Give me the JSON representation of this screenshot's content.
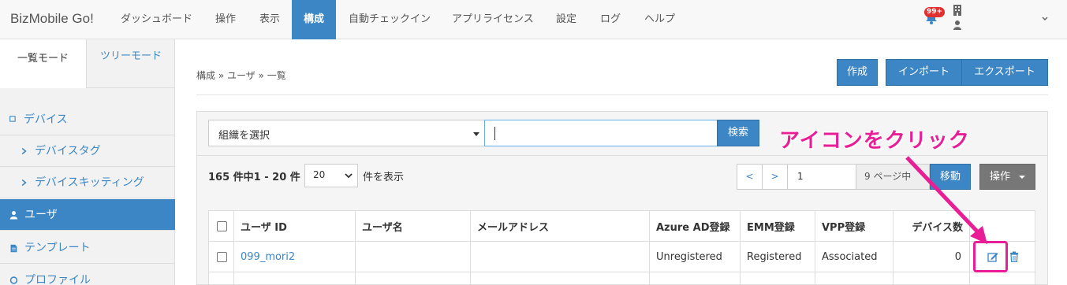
{
  "navbar": {
    "brand": "BizMobile Go!",
    "items": [
      {
        "label": "ダッシュボード"
      },
      {
        "label": "操作"
      },
      {
        "label": "表示"
      },
      {
        "label": "構成"
      },
      {
        "label": "自動チェックイン"
      },
      {
        "label": "アプリライセンス"
      },
      {
        "label": "設定"
      },
      {
        "label": "ログ"
      },
      {
        "label": "ヘルプ"
      }
    ],
    "active_item": "構成",
    "notification_badge": "99+",
    "accent_color": "#3c86c6"
  },
  "sidebar": {
    "mode_tabs": [
      {
        "label": "一覧モード"
      },
      {
        "label": "ツリーモード"
      }
    ],
    "items": [
      {
        "label": "デバイス",
        "icon": "square-icon"
      },
      {
        "label": "デバイスタグ",
        "icon": "chevron-right-icon"
      },
      {
        "label": "デバイスキッティング",
        "icon": "chevron-right-icon"
      },
      {
        "label": "ユーザ",
        "icon": "user-icon",
        "active": true
      },
      {
        "label": "テンプレート",
        "icon": "document-icon"
      },
      {
        "label": "プロファイル",
        "icon": "profile-icon"
      }
    ]
  },
  "main": {
    "breadcrumb": "構成 » ユーザ » 一覧",
    "buttons": {
      "create": "作成",
      "import": "インポート",
      "export": "エクスポート"
    },
    "filter": {
      "org_select": "組織を選択",
      "search_value": "",
      "search_button": "検索"
    },
    "listing": {
      "count_text": "165 件中1 - 20 件",
      "per_page": "20",
      "per_page_label": "件を表示",
      "pager_prev": "<",
      "pager_next": ">",
      "page_input": "1",
      "page_suffix": "9 ページ中",
      "move_button": "移動",
      "action_button": "操作"
    },
    "table": {
      "headers": [
        "ユーザ ID",
        "ユーザ名",
        "メールアドレス",
        "Azure AD登録",
        "EMM登録",
        "VPP登録",
        "デバイス数"
      ],
      "rows": [
        {
          "user_id": "099_mori2",
          "user_name": "",
          "email": "",
          "azure_ad": "Unregistered",
          "emm": "Registered",
          "vpp": "Associated",
          "device_count": "0"
        }
      ]
    }
  },
  "annotation": {
    "text": "アイコンをクリック",
    "color": "#e91e96"
  }
}
